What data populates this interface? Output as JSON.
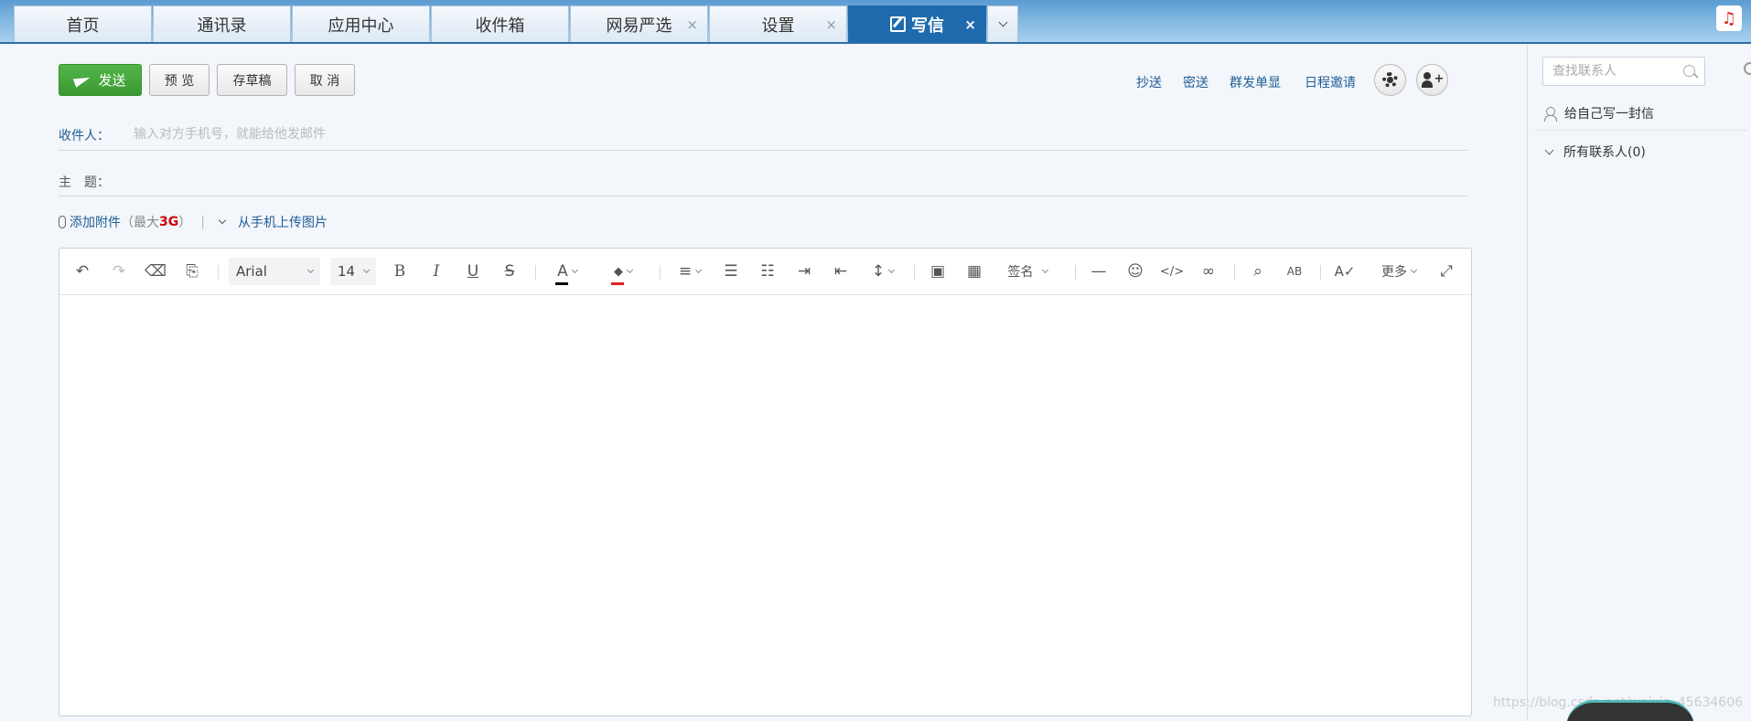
{
  "tabs": [
    {
      "label": "首页",
      "closable": false
    },
    {
      "label": "通讯录",
      "closable": false
    },
    {
      "label": "应用中心",
      "closable": false
    },
    {
      "label": "收件箱",
      "closable": false
    },
    {
      "label": "网易严选",
      "closable": true
    },
    {
      "label": "设置",
      "closable": true
    },
    {
      "label": "写信",
      "closable": true,
      "active": true
    }
  ],
  "tab_close_glyph": "×",
  "music_icon": "♫",
  "actions": {
    "send": "发送",
    "preview": "预 览",
    "draft": "存草稿",
    "cancel": "取 消"
  },
  "links": {
    "cc": "抄送",
    "bcc": "密送",
    "separate_send": "群发单显",
    "schedule_invite": "日程邀请"
  },
  "fields": {
    "recipient_label": "收件人：",
    "recipient_placeholder": "输入对方手机号，就能给他发邮件",
    "recipient_value": "",
    "subject_label": "主　题：",
    "subject_value": ""
  },
  "attachment": {
    "add_label": "添加附件",
    "limit_open": "（最大",
    "limit_value": "3G",
    "limit_close": "）",
    "separator": "|",
    "mobile_upload": "从手机上传图片"
  },
  "toolbar": {
    "undo_glyph": "↶",
    "redo_glyph": "↷",
    "eraser_glyph": "⌫",
    "format_glyph": "⎘",
    "font_family": "Arial",
    "font_size": "14",
    "bold": "B",
    "italic": "I",
    "underline": "U",
    "strike": "S",
    "font_color_glyph": "A",
    "font_color": "#000000",
    "highlight_glyph": "◆",
    "highlight_color": "#e02020",
    "align_glyph": "≡",
    "bullet_glyph": "☰",
    "number_glyph": "☷",
    "indent_glyph": "⇥",
    "outdent_glyph": "⇤",
    "line_height_glyph": "↕",
    "image_glyph": "▣",
    "table_glyph": "▦",
    "signature": "签名",
    "hr_glyph": "—",
    "emoji_glyph": "☺",
    "code_glyph": "</>",
    "link_glyph": "∞",
    "find_glyph": "⌕",
    "case_glyph": "AB",
    "spell_glyph": "A✓",
    "more": "更多",
    "fullscreen_glyph": "⤢"
  },
  "sidebar": {
    "search_placeholder": "查找联系人",
    "write_to_self": "给自己写一封信",
    "all_contacts": "所有联系人(0)"
  },
  "watermark": "https://blog.csdn.net/weixin_45634606",
  "colors": {
    "accent": "#1f6aad",
    "send_button": "#46a83e",
    "link": "#1e5d96",
    "limit_red": "#cc0000"
  }
}
